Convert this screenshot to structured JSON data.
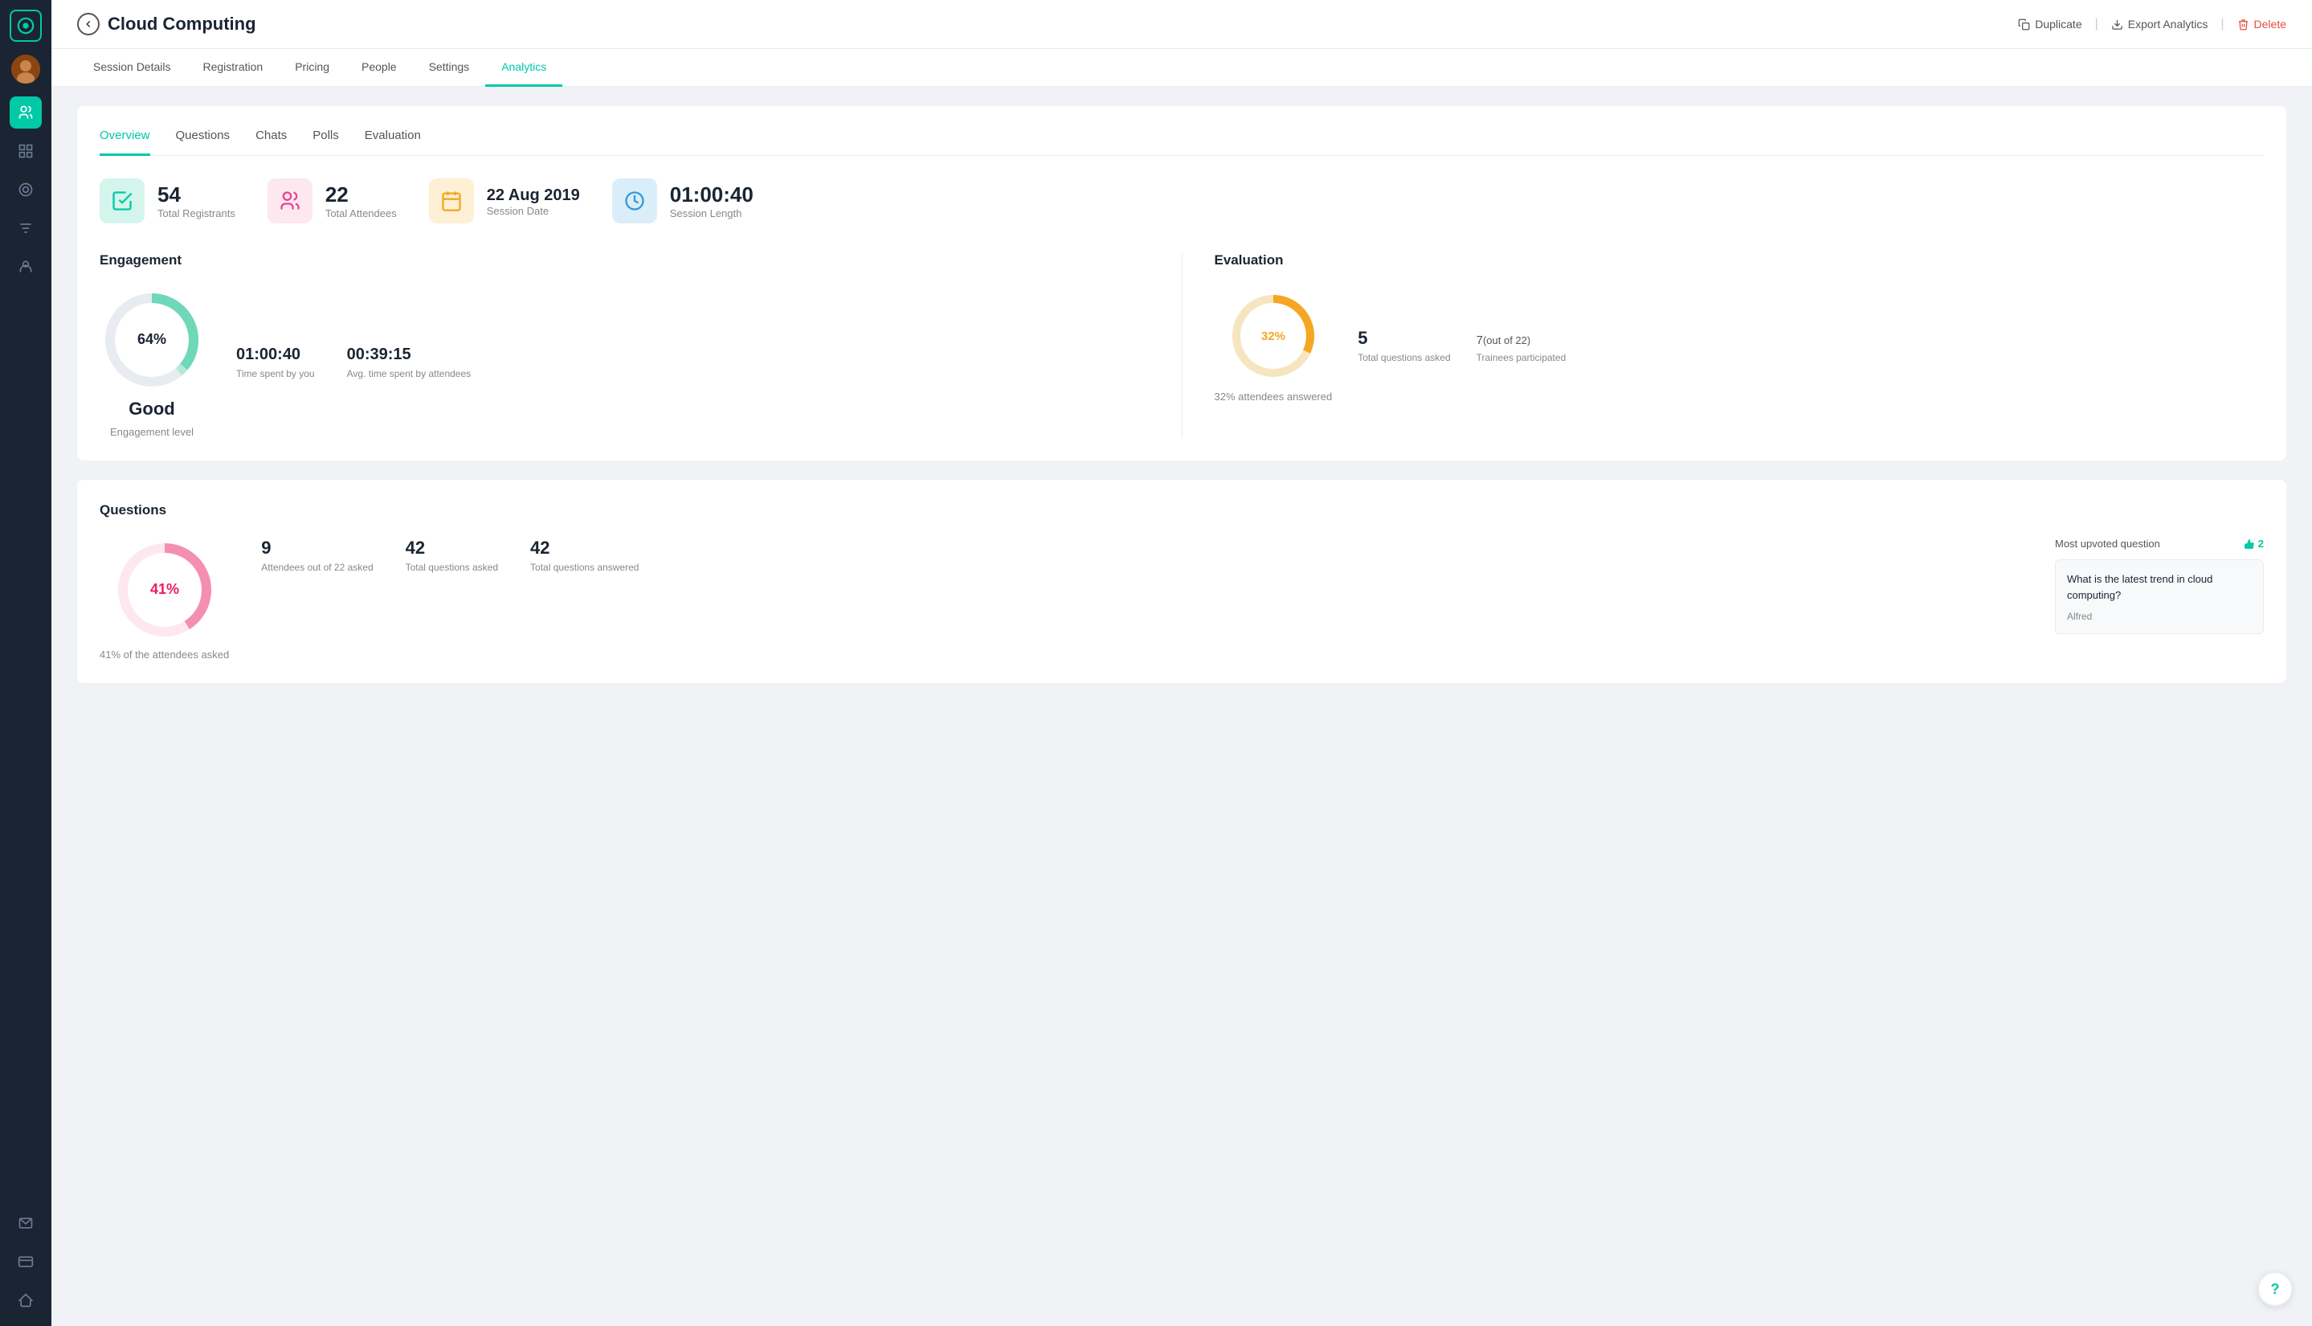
{
  "sidebar": {
    "logo_title": "App Logo",
    "nav_items": [
      {
        "name": "people-icon",
        "label": "People",
        "active": true
      },
      {
        "name": "grid-icon",
        "label": "Grid",
        "active": false
      },
      {
        "name": "circle-icon",
        "label": "Circle",
        "active": false
      },
      {
        "name": "filter-icon",
        "label": "Filter",
        "active": false
      },
      {
        "name": "user-icon",
        "label": "User",
        "active": false
      }
    ],
    "bottom_items": [
      {
        "name": "chat-icon",
        "label": "Chat"
      },
      {
        "name": "card-icon",
        "label": "Card"
      },
      {
        "name": "list-icon",
        "label": "List"
      }
    ]
  },
  "header": {
    "back_label": "Back",
    "title": "Cloud Computing",
    "actions": {
      "duplicate": "Duplicate",
      "export": "Export Analytics",
      "delete": "Delete"
    }
  },
  "nav": {
    "tabs": [
      {
        "label": "Session Details",
        "active": false
      },
      {
        "label": "Registration",
        "active": false
      },
      {
        "label": "Pricing",
        "active": false
      },
      {
        "label": "People",
        "active": false
      },
      {
        "label": "Settings",
        "active": false
      },
      {
        "label": "Analytics",
        "active": true
      }
    ]
  },
  "sub_tabs": [
    {
      "label": "Overview",
      "active": true
    },
    {
      "label": "Questions",
      "active": false
    },
    {
      "label": "Chats",
      "active": false
    },
    {
      "label": "Polls",
      "active": false
    },
    {
      "label": "Evaluation",
      "active": false
    }
  ],
  "stats": [
    {
      "value": "54",
      "label": "Total Registrants",
      "icon_type": "green",
      "icon_name": "registrants-icon"
    },
    {
      "value": "22",
      "label": "Total Attendees",
      "icon_type": "pink",
      "icon_name": "attendees-icon"
    },
    {
      "value": "22 Aug 2019",
      "label": "Session Date",
      "icon_type": "orange",
      "icon_name": "date-icon"
    },
    {
      "value": "01:00:40",
      "label": "Session Length",
      "icon_type": "blue",
      "icon_name": "length-icon"
    }
  ],
  "engagement": {
    "section_title": "Engagement",
    "pie_percent": "64%",
    "pie_label_main": "Good",
    "pie_label_sub": "Engagement level",
    "time_spent_you_label": "Time spent by you",
    "time_spent_you_value": "01:00:40",
    "avg_time_label": "Avg. time spent by attendees",
    "avg_time_value": "00:39:15"
  },
  "evaluation": {
    "section_title": "Evaluation",
    "pie_percent": "32%",
    "attendees_answered": "32% attendees answered",
    "total_questions_value": "5",
    "total_questions_label": "Total questions asked",
    "trainees_value": "7",
    "trainees_out_of": "(out of 22)",
    "trainees_label": "Trainees participated"
  },
  "questions": {
    "section_title": "Questions",
    "pie_percent": "41%",
    "pie_sub": "41% of the attendees asked",
    "attendees_asked_value": "9",
    "attendees_asked_label": "Attendees out of 22 asked",
    "total_asked_value": "42",
    "total_asked_label": "Total questions asked",
    "total_answered_value": "42",
    "total_answered_label": "Total questions answered",
    "upvoted_title": "Most upvoted question",
    "upvoted_count": "2",
    "upvoted_question": "What is the latest trend in cloud computing?",
    "upvoted_author": "Alfred"
  },
  "help": {
    "label": "?"
  }
}
